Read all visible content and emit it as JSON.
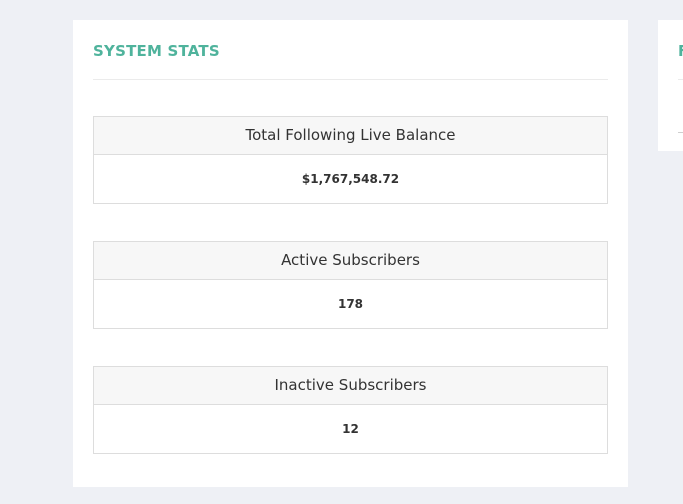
{
  "system_stats": {
    "title": "SYSTEM STATS",
    "stats": [
      {
        "label": "Total Following Live Balance",
        "value": "$1,767,548.72"
      },
      {
        "label": "Active Subscribers",
        "value": "178"
      },
      {
        "label": "Inactive Subscribers",
        "value": "12"
      }
    ]
  },
  "side_panel": {
    "title_fragment": "F"
  },
  "colors": {
    "page_background": "#eef0f5",
    "panel_background": "#ffffff",
    "title_accent": "#4fb39c",
    "stat_header_background": "#f7f7f7",
    "border": "#dddddd",
    "text": "#333333"
  }
}
